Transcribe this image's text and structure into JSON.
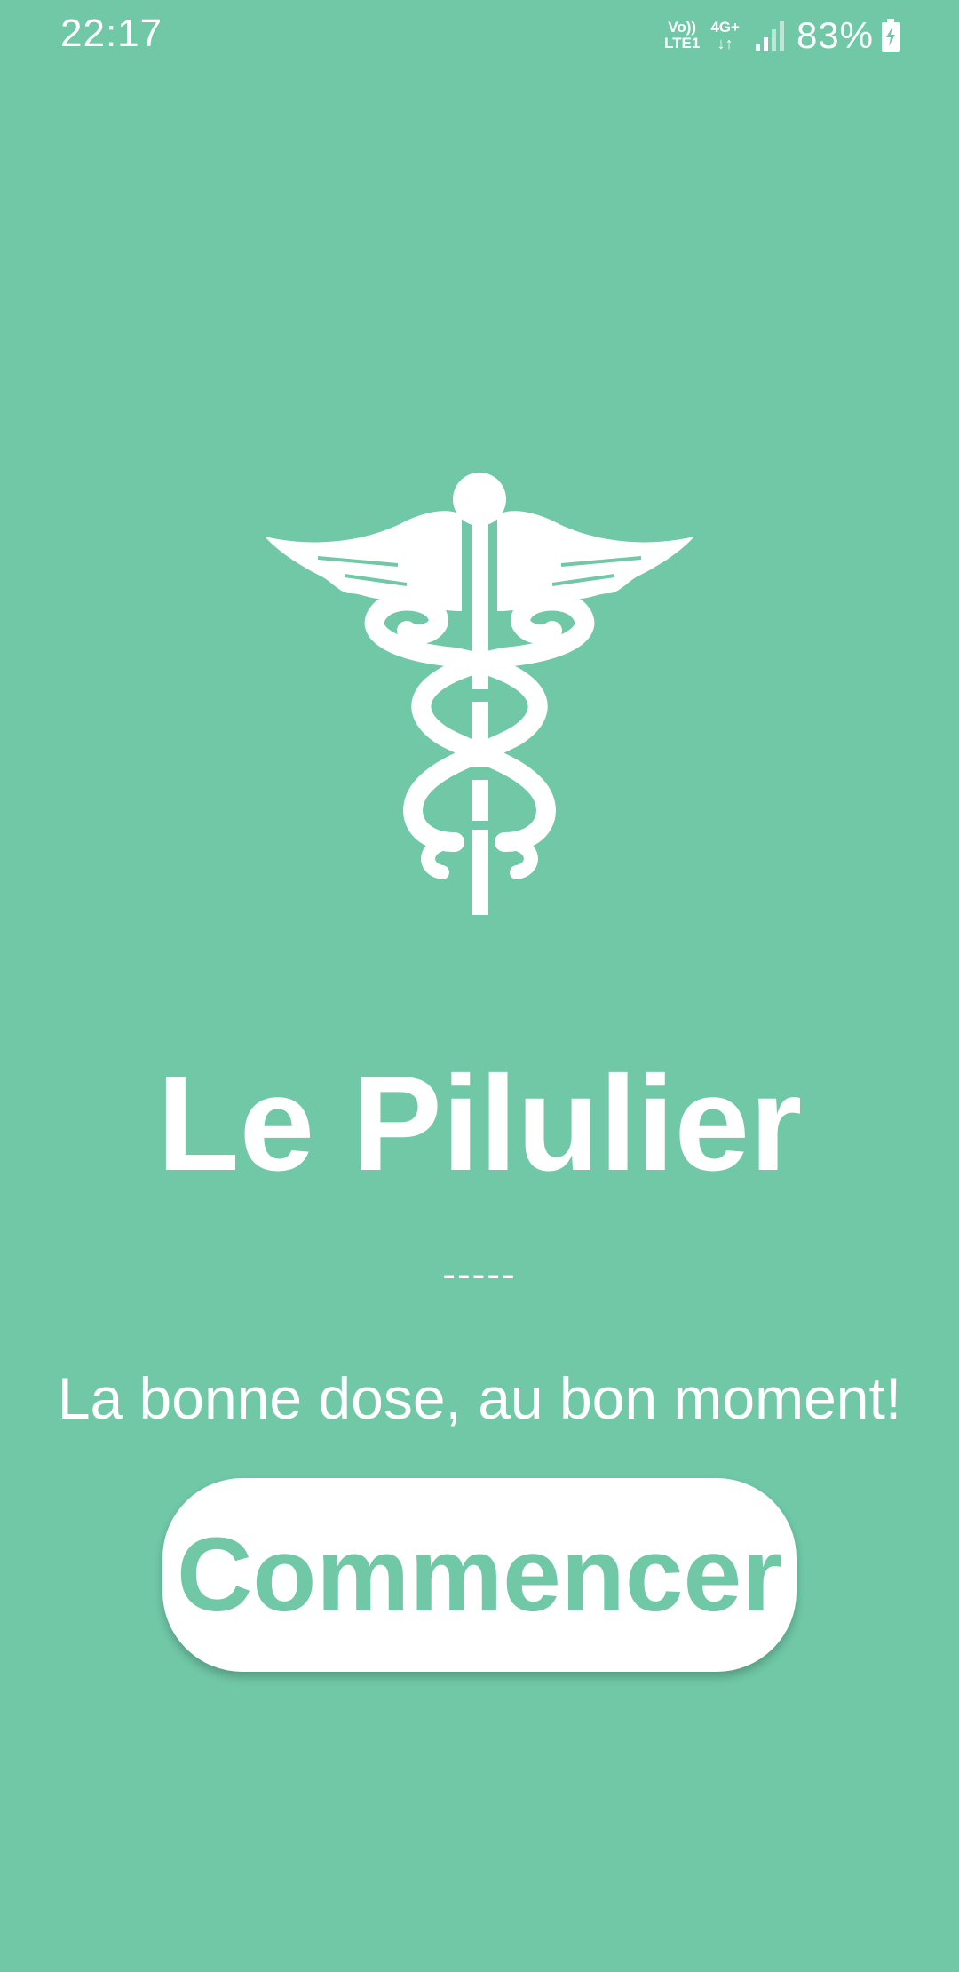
{
  "status_bar": {
    "time": "22:17",
    "volte_label": "Vo))",
    "lte_label": "LTE1",
    "network_label": "4G+",
    "network_arrows": "↓↑",
    "battery_percent": "83%",
    "battery_level": 0.83,
    "charging": true
  },
  "app": {
    "title": "Le Pilulier",
    "divider": "-----",
    "tagline": "La bonne dose, au bon moment!",
    "start_button_label": "Commencer"
  },
  "colors": {
    "background": "#70C8A7",
    "foreground": "#FFFFFF",
    "button_text": "#70C8A7"
  },
  "icons": {
    "logo": "caduceus-icon",
    "signal": "signal-icon",
    "battery": "battery-charging-icon"
  }
}
